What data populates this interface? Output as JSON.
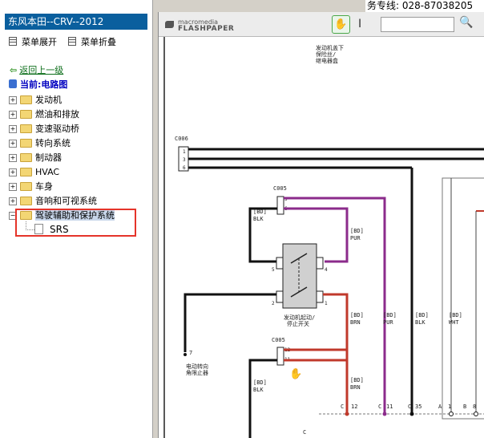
{
  "sidebar": {
    "title": "东风本田--CRV--2012",
    "expand_label": "菜单展开",
    "collapse_label": "菜单折叠",
    "back_label": "返回上一级",
    "current_label": "当前:电路图",
    "tree": [
      {
        "label": "发动机"
      },
      {
        "label": "燃油和排放"
      },
      {
        "label": "变速驱动桥"
      },
      {
        "label": "转向系统"
      },
      {
        "label": "制动器"
      },
      {
        "label": "HVAC"
      },
      {
        "label": "车身"
      },
      {
        "label": "音响和可视系统"
      },
      {
        "label": "驾驶辅助和保护系统"
      }
    ],
    "child_label": "SRS"
  },
  "header": {
    "hotline": "务专线: 028-87038205"
  },
  "viewer": {
    "logo_top": "macromedia",
    "logo_bottom": "FLASHPAPER",
    "text_tool": "I",
    "search_icon": "🔍",
    "hand_icon": "✋"
  },
  "diagram": {
    "top_note": [
      "发动机盖下",
      "保险丝/",
      "继电器盒"
    ],
    "connector_c006": "C006",
    "pins_c006": [
      "1",
      "3",
      "6"
    ],
    "connector_c005a": "C005",
    "pins_c005a": [
      "5",
      "6"
    ],
    "wire_bd": "[BD]",
    "blk": "BLK",
    "pur": "PUR",
    "brn": "BRN",
    "wht": "WHT",
    "switch_pins": [
      "5",
      "4",
      "2",
      "1"
    ],
    "switch_label": [
      "发动机起动/",
      "停止开关"
    ],
    "pin7": "7",
    "left_note": [
      "电动转向",
      "角限止器"
    ],
    "connector_c005b": "C005",
    "pins_c005b": [
      "12",
      "11"
    ],
    "bottom_c": "C",
    "bottom_pins": [
      "12",
      "11",
      "35",
      "1",
      "8"
    ],
    "bottom_a": "A",
    "bottom_b": "B"
  },
  "colors": {
    "purple": "#8b2b8b",
    "red": "#c0392b",
    "black": "#111111",
    "title_bg": "#0a5f9e",
    "highlight": "#e5342a"
  }
}
